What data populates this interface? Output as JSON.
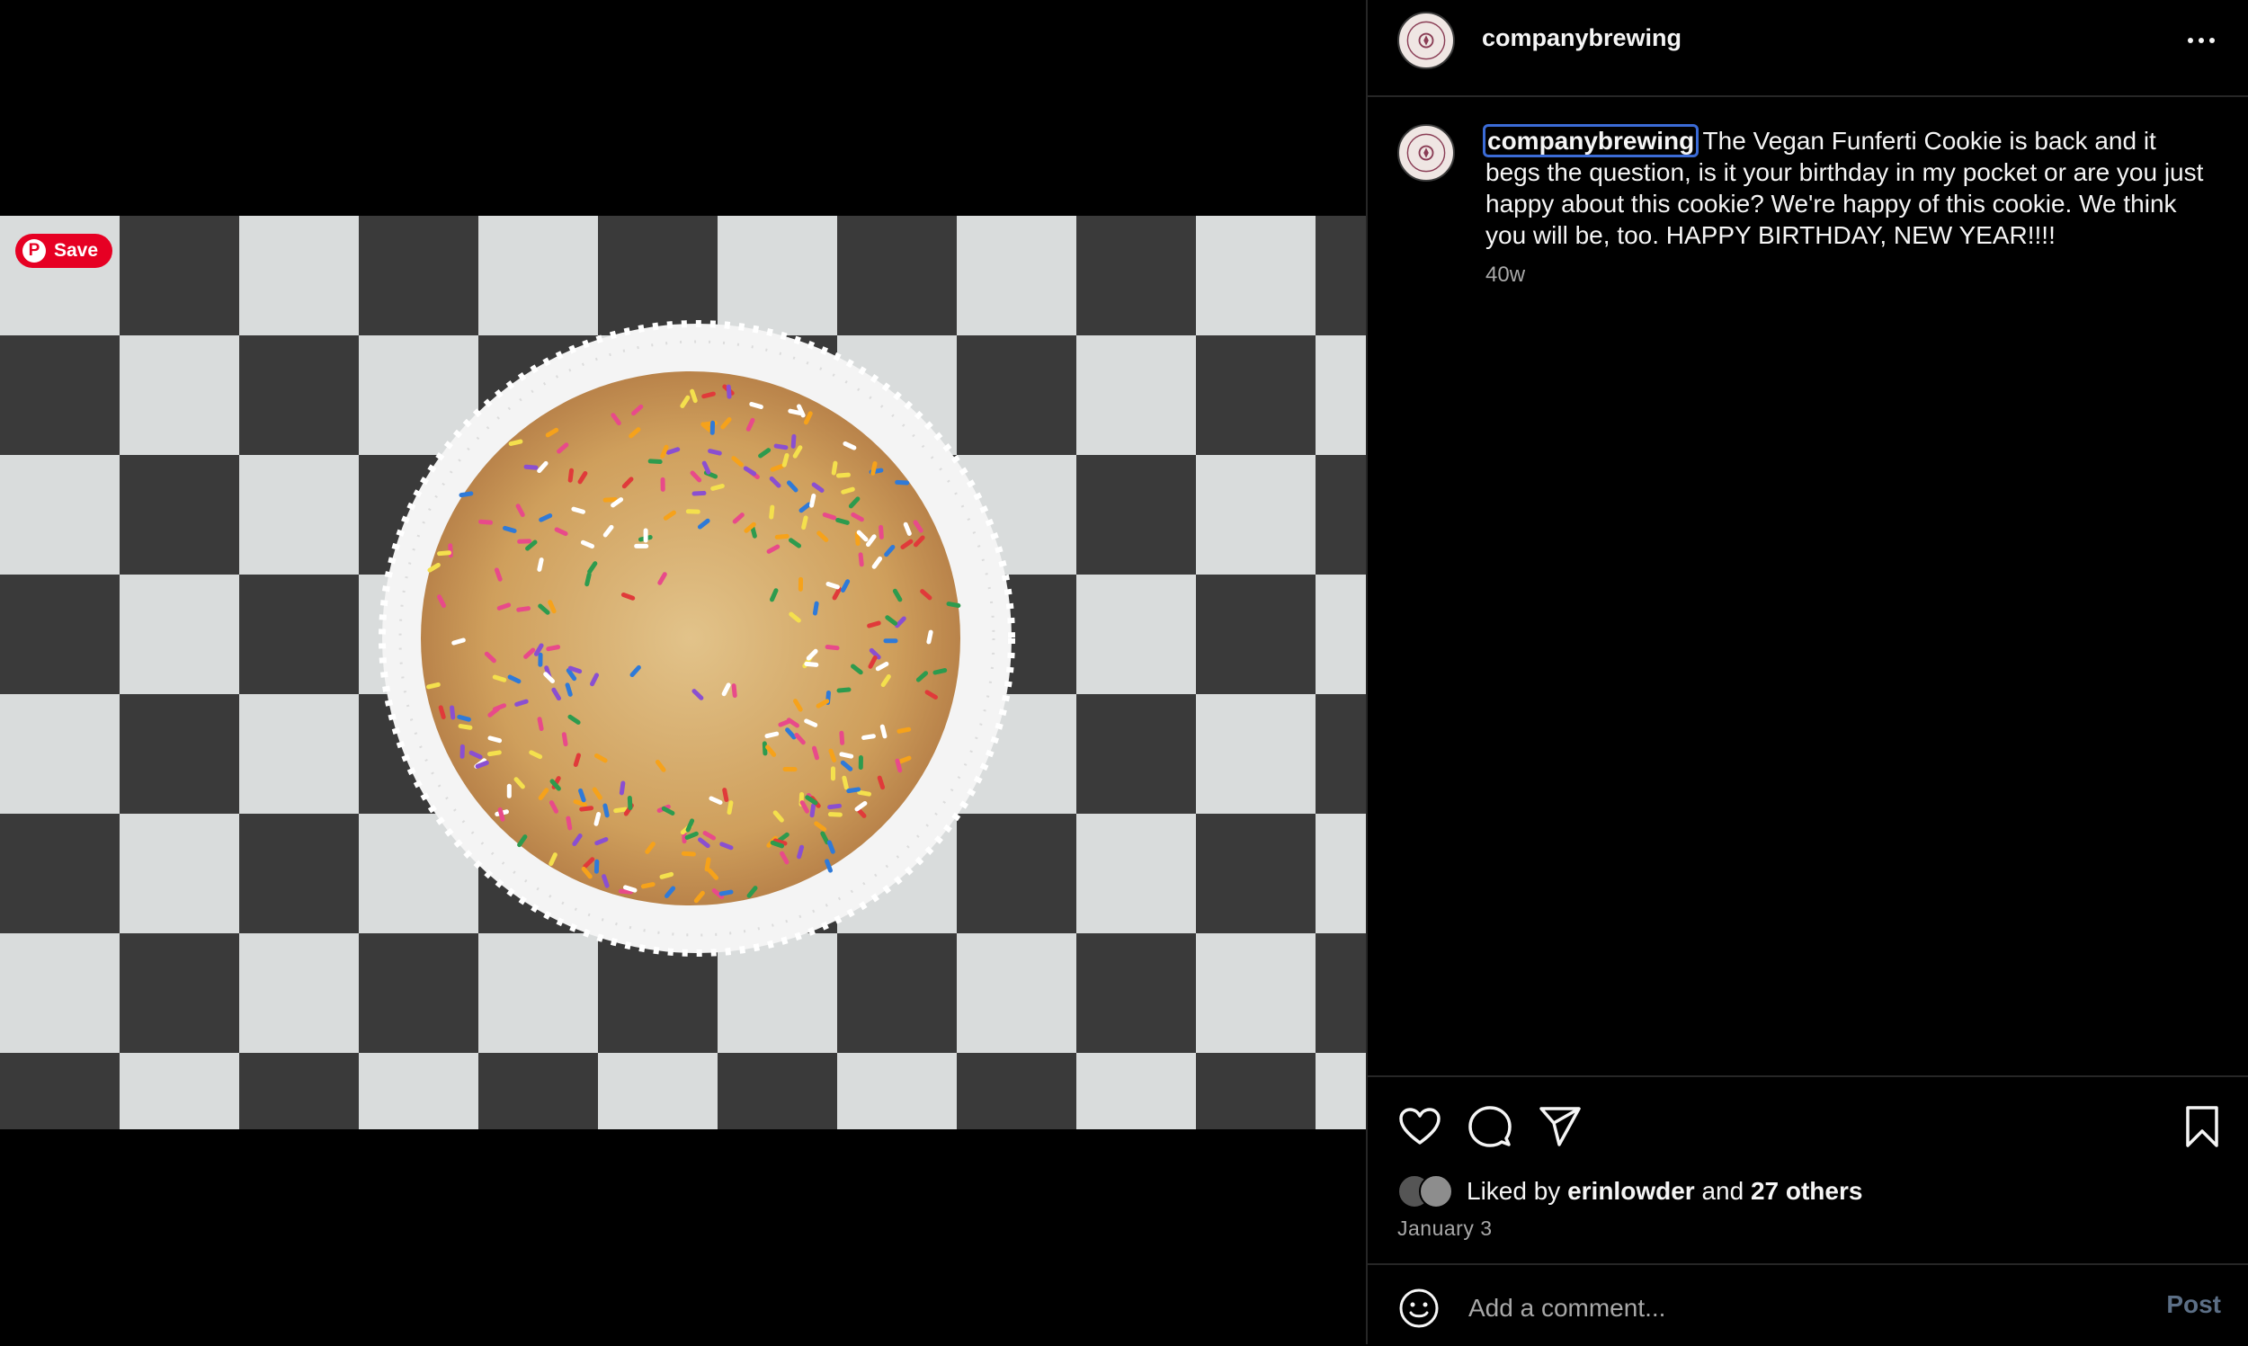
{
  "media": {
    "alt": "",
    "pin_save_label": "Save"
  },
  "post": {
    "username": "companybrewing",
    "caption": "The Vegan Funferti Cookie is back and it begs the question, is it your birthday in my pocket or are you just happy about this cookie? We're happy of this cookie. We think you will be, too. HAPPY BIRTHDAY, NEW YEAR!!!!",
    "time_ago": "40w",
    "date": "January 3"
  },
  "likes": {
    "prefix": "Liked by",
    "user": "erinlowder",
    "joiner": "and",
    "others": "27 others"
  },
  "comment": {
    "placeholder": "Add a comment...",
    "post_label": "Post"
  },
  "icons": {
    "more": "more-horizontal-icon",
    "like": "heart-icon",
    "comment": "comment-bubble-icon",
    "share": "paper-plane-icon",
    "save": "bookmark-icon",
    "emoji": "smiley-icon",
    "pinterest": "pinterest-icon"
  },
  "colors": {
    "background": "#000000",
    "text": "#f5f5f5",
    "muted": "#a8a8a8",
    "divider": "#262626",
    "pinterest_red": "#e60023",
    "post_button": "#5c6f86",
    "focus_outline": "#3b6bd6"
  }
}
